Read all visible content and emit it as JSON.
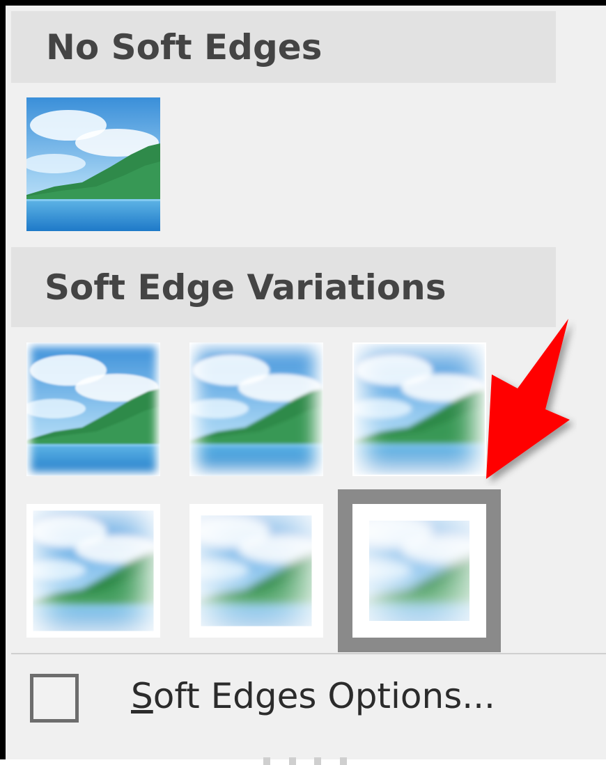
{
  "menu": {
    "no_soft_edges_header": "No Soft Edges",
    "variations_header": "Soft Edge Variations",
    "options_label_accel": "S",
    "options_label_rest": "oft Edges Options..."
  },
  "thumbnails": {
    "none": {
      "blur_level": 0
    },
    "variations": [
      {
        "blur_level": 1
      },
      {
        "blur_level": 2
      },
      {
        "blur_level": 3
      },
      {
        "blur_level": 4
      },
      {
        "blur_level": 5
      },
      {
        "blur_level": 6,
        "selected": true
      }
    ]
  },
  "colors": {
    "header_bg": "#e2e2e2",
    "panel_bg": "#f0f0f0",
    "selection_border": "#8a8a8a",
    "arrow": "#ff0000"
  },
  "icons": {
    "arrow": "red-pointer-arrow-icon",
    "checkbox": "checkbox-icon"
  }
}
